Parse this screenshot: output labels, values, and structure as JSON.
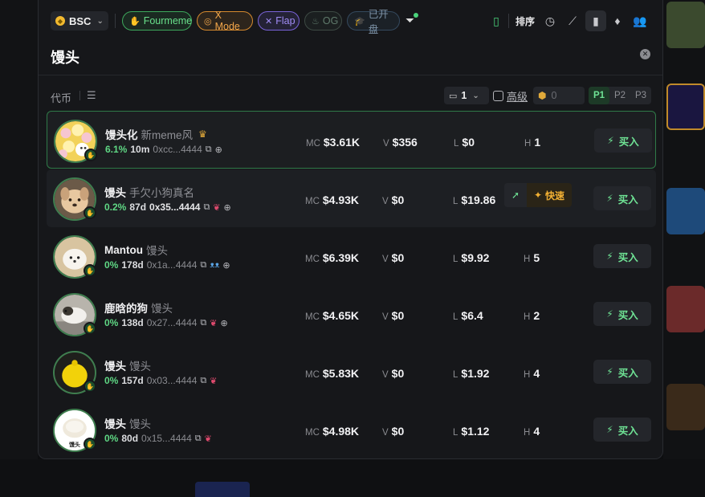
{
  "header": {
    "chain": "BSC",
    "chips": [
      "Fourmeme",
      "X Mode",
      "Flap",
      "OG",
      "已开盘"
    ],
    "sort_label": "排序"
  },
  "search": {
    "value": "馒头"
  },
  "filters": {
    "coin_label": "代币",
    "page_select": "1",
    "advanced_label": "高级",
    "amount_value": "0",
    "pages": [
      "P1",
      "P2",
      "P3"
    ]
  },
  "buy_label": "买入",
  "fast_label": "快速",
  "stat_keys": {
    "mc": "MC",
    "v": "V",
    "l": "L",
    "h": "H"
  },
  "rows": [
    {
      "name": "馒头化",
      "sub": "新meme风",
      "pct": "6.1%",
      "age": "10m",
      "addr": "0xcc...4444",
      "mc": "$3.61K",
      "v": "$356",
      "l": "$0",
      "h": "1"
    },
    {
      "name": "馒头",
      "sub": "手欠小狗真名",
      "pct": "0.2%",
      "age": "87d",
      "addr": "0x35...4444",
      "mc": "$4.93K",
      "v": "$0",
      "l": "$19.86",
      "h": ""
    },
    {
      "name": "Mantou",
      "sub": "馒头",
      "pct": "0%",
      "age": "178d",
      "addr": "0x1a...4444",
      "mc": "$6.39K",
      "v": "$0",
      "l": "$9.92",
      "h": "5"
    },
    {
      "name": "鹿晗的狗",
      "sub": "馒头",
      "pct": "0%",
      "age": "138d",
      "addr": "0x27...4444",
      "mc": "$4.65K",
      "v": "$0",
      "l": "$6.4",
      "h": "2"
    },
    {
      "name": "馒头",
      "sub": "馒头",
      "pct": "0%",
      "age": "157d",
      "addr": "0x03...4444",
      "mc": "$5.83K",
      "v": "$0",
      "l": "$1.92",
      "h": "4"
    },
    {
      "name": "馒头",
      "sub": "馒头",
      "pct": "0%",
      "age": "80d",
      "addr": "0x15...4444",
      "mc": "$4.98K",
      "v": "$0",
      "l": "$1.12",
      "h": "4"
    }
  ],
  "avatar_6_caption": "馒头"
}
